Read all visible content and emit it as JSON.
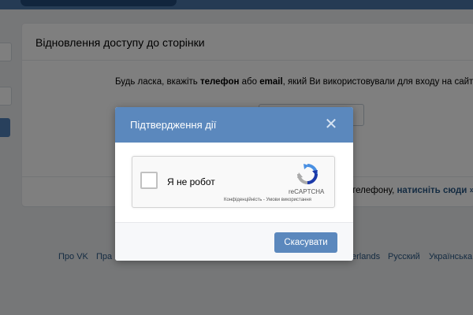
{
  "page": {
    "card_title": "Відновлення доступу до сторінки",
    "instruction_pre": "Будь ласка, вкажіть ",
    "instruction_bold1": "телефон",
    "instruction_mid": " або ",
    "instruction_bold2": "email",
    "instruction_post": ", який Ви використовували для входу на сайт.",
    "bottom_text": "телефону, ",
    "bottom_link": "натисніть сюди »"
  },
  "footer": {
    "links": [
      "Про VK",
      "Пра",
      "erlands",
      "Русский",
      "Українська"
    ]
  },
  "modal": {
    "title": "Підтвердження дії",
    "close_glyph": "✕",
    "recaptcha": {
      "label": "Я не робот",
      "brand": "reCAPTCHA",
      "terms": "Конфіденційність - Умови використання"
    },
    "cancel_label": "Скасувати"
  },
  "colors": {
    "header": "#5b88bd",
    "button": "#5b88bd",
    "link": "#2a5885",
    "recaptcha_blue": "#1c3aa9",
    "recaptcha_lightblue": "#4a90e2",
    "recaptcha_gray": "#ababab"
  }
}
